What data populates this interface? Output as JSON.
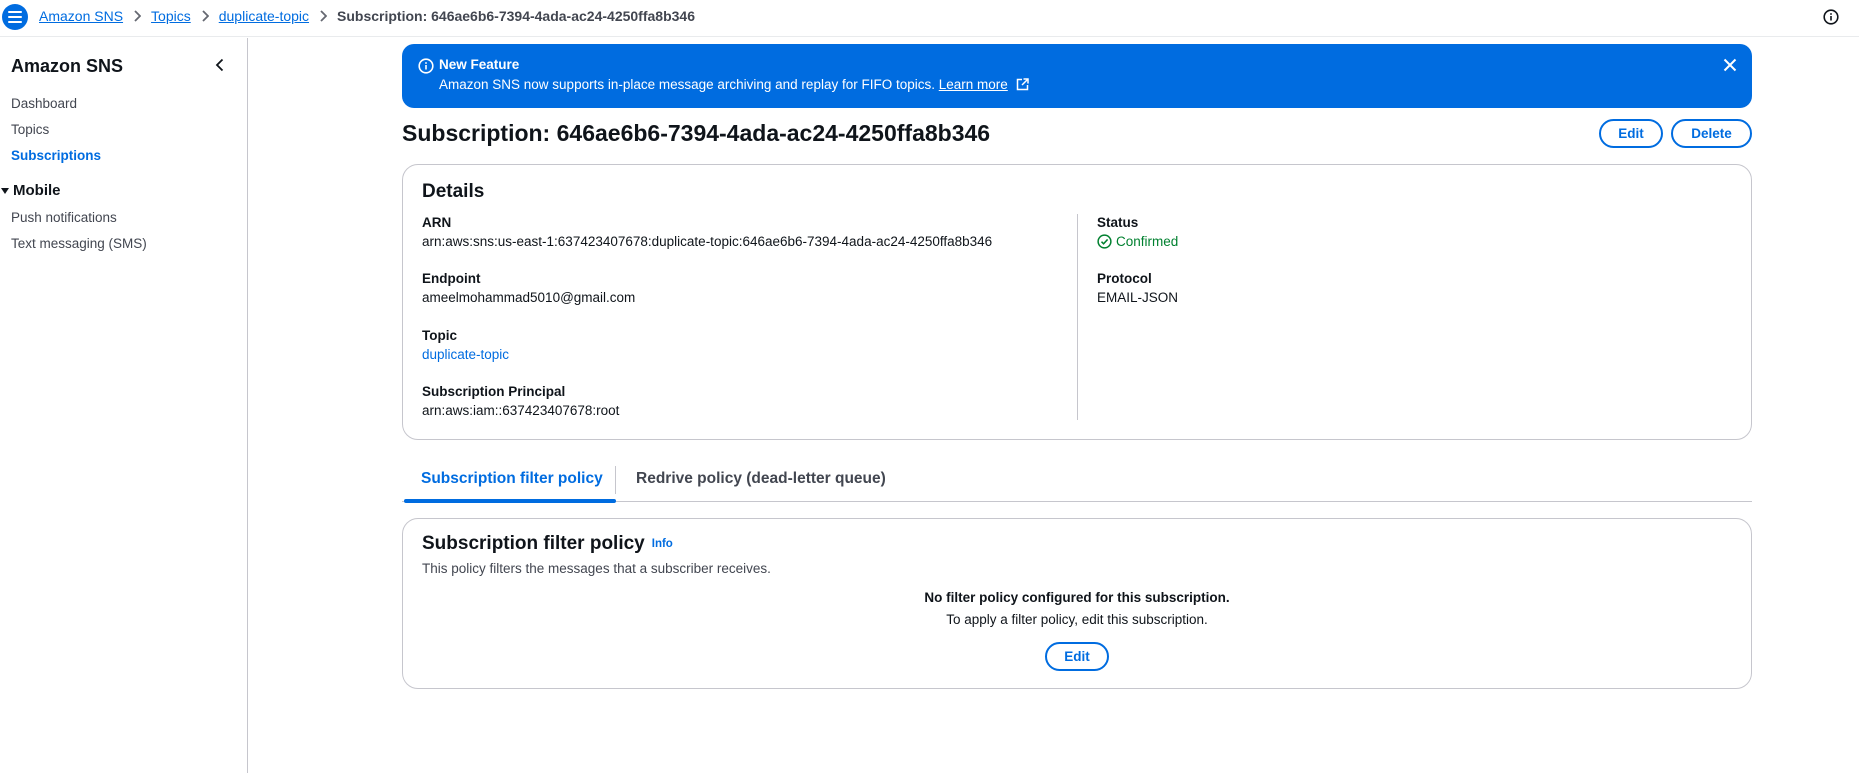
{
  "breadcrumb": {
    "items": [
      "Amazon SNS",
      "Topics",
      "duplicate-topic"
    ],
    "current": "Subscription: 646ae6b6-7394-4ada-ac24-4250ffa8b346"
  },
  "sidebar": {
    "title": "Amazon SNS",
    "items": [
      {
        "label": "Dashboard"
      },
      {
        "label": "Topics"
      },
      {
        "label": "Subscriptions"
      }
    ],
    "section": {
      "label": "Mobile",
      "items": [
        {
          "label": "Push notifications"
        },
        {
          "label": "Text messaging (SMS)"
        }
      ]
    }
  },
  "flash": {
    "title": "New Feature",
    "message": "Amazon SNS now supports in-place message archiving and replay for FIFO topics.",
    "link": "Learn more",
    "color": "#006ce0"
  },
  "header": {
    "title": "Subscription: 646ae6b6-7394-4ada-ac24-4250ffa8b346",
    "edit_label": "Edit",
    "delete_label": "Delete"
  },
  "details": {
    "title": "Details",
    "arn_label": "ARN",
    "arn_value": "arn:aws:sns:us-east-1:637423407678:duplicate-topic:646ae6b6-7394-4ada-ac24-4250ffa8b346",
    "endpoint_label": "Endpoint",
    "endpoint_value": "ameelmohammad5010@gmail.com",
    "topic_label": "Topic",
    "topic_value": "duplicate-topic",
    "principal_label": "Subscription Principal",
    "principal_value": "arn:aws:iam::637423407678:root",
    "status_label": "Status",
    "status_value": "Confirmed",
    "status_color": "#00802f",
    "protocol_label": "Protocol",
    "protocol_value": "EMAIL-JSON"
  },
  "tabs": [
    {
      "label": "Subscription filter policy",
      "active": true
    },
    {
      "label": "Redrive policy (dead-letter queue)",
      "active": false
    }
  ],
  "filter_policy": {
    "title": "Subscription filter policy",
    "info_label": "Info",
    "description": "This policy filters the messages that a subscriber receives.",
    "empty_title": "No filter policy configured for this subscription.",
    "empty_message": "To apply a filter policy, edit this subscription.",
    "edit_label": "Edit"
  },
  "icons": [
    "menu-icon",
    "chevron-right-icon",
    "info-icon",
    "chevron-left-icon",
    "caret-down-icon",
    "external-link-icon",
    "close-icon",
    "check-circle-icon"
  ]
}
